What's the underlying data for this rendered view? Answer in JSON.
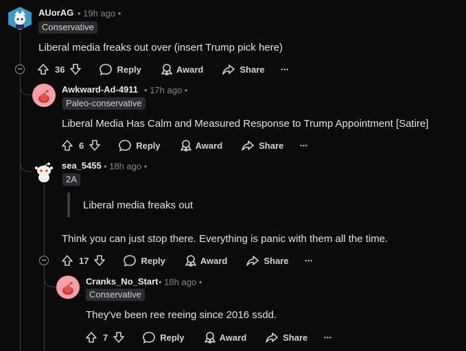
{
  "comments": [
    {
      "username": "AUorAG",
      "time": "• 19h ago •",
      "flair": "Conservative",
      "body": "Liberal media freaks out over (insert Trump pick here)",
      "votes": "36",
      "reply": "Reply",
      "award": "Award",
      "share": "Share",
      "more": "•••"
    },
    {
      "username": "Awkward-Ad-4911",
      "time": "• 17h ago •",
      "flair": "Paleo-conservative",
      "body": "Liberal Media Has Calm and Measured Response to Trump Appointment [Satire]",
      "votes": "6",
      "reply": "Reply",
      "award": "Award",
      "share": "Share",
      "more": "•••"
    },
    {
      "username": "sea_5455",
      "time": "• 18h ago •",
      "flair": "2A",
      "quote": "Liberal media freaks out",
      "body": "Think you can just stop there. Everything is panic with them all the time.",
      "votes": "17",
      "reply": "Reply",
      "award": "Award",
      "share": "Share",
      "more": "•••"
    },
    {
      "username": "Cranks_No_Start",
      "time": "• 18h ago •",
      "flair": "Conservative",
      "body": "They've been ree reeing since 2016 ssdd.",
      "votes": "7",
      "reply": "Reply",
      "award": "Award",
      "share": "Share",
      "more": "•••"
    }
  ]
}
